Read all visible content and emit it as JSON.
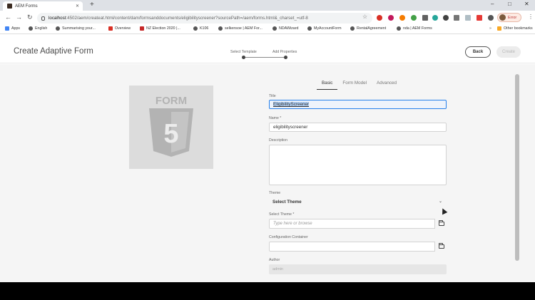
{
  "browser": {
    "tab_title": "AEM Forms",
    "new_tab": "+",
    "url_host": "localhost",
    "url_path": ":4502/aem/createat.html/content/dam/formsanddocuments/eligibilityscreener?sourcePath=/aem/forms.html&_charset_=utf-8",
    "profile_label": "Error",
    "win_minimize": "–",
    "win_restore": "□",
    "win_close": "✕",
    "back": "←",
    "forward": "→",
    "reload": "↻",
    "star": "☆",
    "menu": "⋮"
  },
  "bookmarks": {
    "items": [
      {
        "label": "Apps",
        "color": "#4285f4"
      },
      {
        "label": "English",
        "color": "#555555"
      },
      {
        "label": "Summarising your...",
        "color": "#555555"
      },
      {
        "label": "Overview",
        "color": "#d93025"
      },
      {
        "label": "NZ Election 2020 |...",
        "color": "#c62828"
      },
      {
        "label": "K106",
        "color": "#555555"
      },
      {
        "label": "selkensoe | AEM For...",
        "color": "#555555"
      },
      {
        "label": "NDAWizard",
        "color": "#555555"
      },
      {
        "label": "MyAccountForm",
        "color": "#555555"
      },
      {
        "label": "RentalAgreement",
        "color": "#555555"
      },
      {
        "label": "nda | AEM Forms",
        "color": "#555555"
      }
    ],
    "other": "Other bookmarks"
  },
  "header": {
    "title": "Create Adaptive Form",
    "step1": "Select Template",
    "step2": "Add Properties",
    "back_label": "Back",
    "create_label": "Create"
  },
  "thumbnail": {
    "text": "FORM",
    "glyph": "5"
  },
  "tabs": [
    {
      "label": "Basic",
      "active": true
    },
    {
      "label": "Form Model",
      "active": false
    },
    {
      "label": "Advanced",
      "active": false
    }
  ],
  "form": {
    "title_label": "Title",
    "title_value": "EligibilityScreener",
    "name_label": "Name *",
    "name_value": "eligibilityscreener",
    "description_label": "Description",
    "theme_label": "Theme",
    "theme_value": "Select Theme",
    "select_theme_label": "Select Theme *",
    "select_theme_placeholder": "Type here or browse",
    "config_label": "Configuration Container",
    "author_label": "Author",
    "author_value": "admin"
  },
  "colors": {
    "accent": "#2680eb",
    "thumb_bg": "#dcdcdc",
    "thumb_fg": "#b3b3b3"
  }
}
